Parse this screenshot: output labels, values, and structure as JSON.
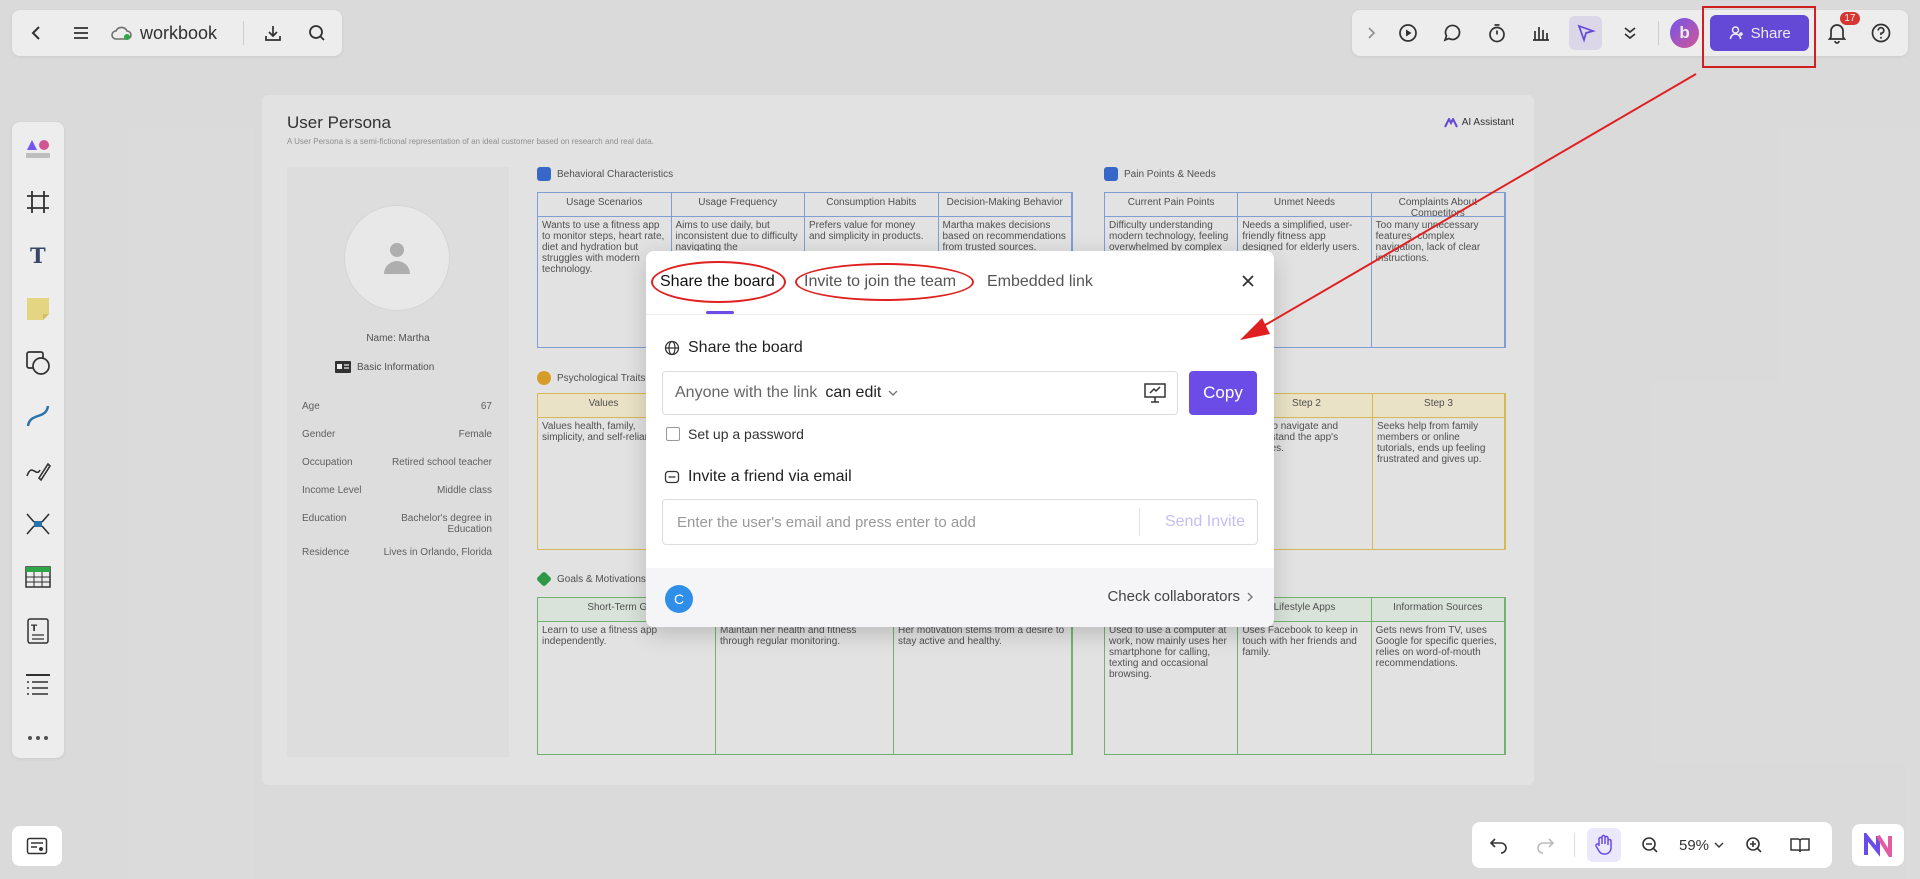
{
  "app": {
    "doc_title": "workbook"
  },
  "topbar": {
    "share_label": "Share",
    "notification_count": "17",
    "avatar_letter": "b"
  },
  "board": {
    "title": "User Persona",
    "subtitle": "A User Persona is a semi-fictional representation of an ideal customer based on research and real data.",
    "ai_label": "AI Assistant",
    "profile": {
      "name": "Name: Martha",
      "basic_info": "Basic Information",
      "rows": [
        {
          "k": "Age",
          "v": "67"
        },
        {
          "k": "Gender",
          "v": "Female"
        },
        {
          "k": "Occupation",
          "v": "Retired school teacher"
        },
        {
          "k": "Income Level",
          "v": "Middle class"
        },
        {
          "k": "Education",
          "v": "Bachelor's degree in Education"
        },
        {
          "k": "Residence",
          "v": "Lives in Orlando, Florida"
        }
      ]
    },
    "behavioral": {
      "title": "Behavioral Characteristics",
      "headers": [
        "Usage Scenarios",
        "Usage Frequency",
        "Consumption Habits",
        "Decision-Making Behavior"
      ],
      "cells": [
        "Wants to use a fitness app to monitor steps, heart rate, diet and hydration but struggles with modern technology.",
        "Aims to use daily, but inconsistent due to difficulty navigating the",
        "Prefers value for money and simplicity in products.",
        "Martha makes decisions based on recommendations from trusted sources."
      ]
    },
    "pain": {
      "title": "Pain Points & Needs",
      "headers": [
        "Current Pain Points",
        "Unmet Needs",
        "Complaints About Competitors"
      ],
      "cells": [
        "Difficulty understanding modern technology, feeling overwhelmed by complex",
        "Needs a simplified, user-friendly fitness app designed for elderly users.",
        "Too many unnecessary features, complex navigation, lack of clear instructions."
      ]
    },
    "psych": {
      "title": "Psychological Traits",
      "header_left": "Values",
      "cell_left": "Values health, family, simplicity, and self-reliance.",
      "headers_right": [
        "Step 2",
        "Step 3"
      ],
      "cells_right": [
        "Tries to navigate and understand the app's features.",
        "Seeks help from family members or online tutorials, ends up feeling frustrated and gives up."
      ]
    },
    "goals": {
      "title": "Goals & Motivations",
      "headers": [
        "Short-Term Goals",
        "",
        ""
      ],
      "cells": [
        "Learn to use a fitness app independently.",
        "Maintain her health and fitness through regular monitoring.",
        "Her motivation stems from a desire to stay active and healthy."
      ]
    },
    "lifestyle": {
      "headers": [
        "",
        "Lifestyle Apps",
        "Information Sources"
      ],
      "cells": [
        "Used to use a computer at work, now mainly uses her smartphone for calling, texting and occasional browsing.",
        "Uses Facebook to keep in touch with her friends and family.",
        "Gets news from TV, uses Google for specific queries, relies on word-of-mouth recommendations."
      ]
    }
  },
  "modal": {
    "tabs": [
      "Share the board",
      "Invite to join the team",
      "Embedded link"
    ],
    "share_section": "Share the board",
    "link_label": "Anyone with the link",
    "permission": "can edit",
    "copy_label": "Copy",
    "password_label": "Set up a password",
    "invite_section": "Invite a friend via email",
    "email_placeholder": "Enter the user's email and press enter to add",
    "send_label": "Send Invite",
    "collaborator_initial": "C",
    "check_collaborators": "Check collaborators"
  },
  "bottom": {
    "zoom": "59%"
  },
  "colors": {
    "accent": "#6b4ce6",
    "annotation_red": "#e02020"
  }
}
